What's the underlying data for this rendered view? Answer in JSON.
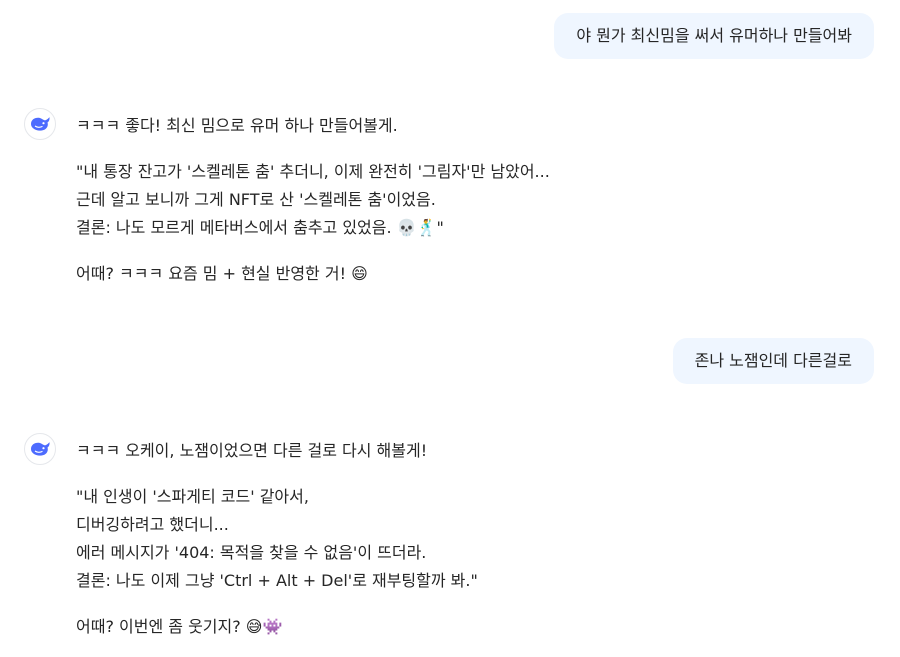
{
  "messages": [
    {
      "role": "user",
      "text": "야 뭔가 최신밈을 써서 유머하나 만들어봐"
    },
    {
      "role": "assistant",
      "intro": "ㅋㅋㅋ 좋다! 최신 밈으로 유머 하나 만들어볼게.",
      "quote_lines": [
        "\"내 통장 잔고가 '스켈레톤 춤' 추더니, 이제 완전히 '그림자'만 남았어...",
        "근데 알고 보니까 그게 NFT로 산 '스켈레톤 춤'이었음.",
        "결론: 나도 모르게 메타버스에서 춤추고 있었음. 💀🕺\""
      ],
      "outro": "어때? ㅋㅋㅋ 요즘 밈 + 현실 반영한 거! 😄"
    },
    {
      "role": "user",
      "text": "존나 노잼인데 다른걸로"
    },
    {
      "role": "assistant",
      "intro": "ㅋㅋㅋ 오케이, 노잼이었으면 다른 걸로 다시 해볼게!",
      "quote_lines": [
        "\"내 인생이 '스파게티 코드' 같아서,",
        "디버깅하려고 했더니...",
        "에러 메시지가 '404: 목적을 찾을 수 없음'이 뜨더라.",
        "결론: 나도 이제 그냥 'Ctrl + Alt + Del'로 재부팅할까 봐.\""
      ],
      "outro": "어때? 이번엔 좀 웃기지? 😅👾"
    }
  ],
  "icons": {
    "avatar": "whale-logo-icon"
  },
  "colors": {
    "user_bubble": "#eff6ff",
    "logo": "#4d6bfe",
    "text": "#262626"
  }
}
